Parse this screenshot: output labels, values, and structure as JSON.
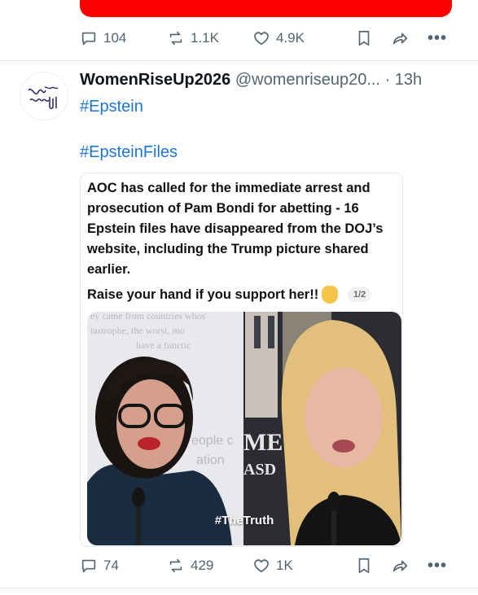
{
  "prev_post": {
    "actions": {
      "replies": "104",
      "reposts": "1.1K",
      "likes": "4.9K"
    }
  },
  "post": {
    "author_name": "WomenRiseUp2026",
    "author_handle": "@womenriseup20...",
    "separator": " · ",
    "time": "13h",
    "hashtags": [
      "#Epstein",
      "#EpsteinFiles"
    ],
    "card": {
      "text": "AOC has called for the immediate arrest and prosecution of Pam Bondi for abetting - 16 Epstein files have disappeared from the DOJ’s website, including the Trump picture shared earlier.",
      "raise_text": "Raise your hand if you support her!!",
      "page_indicator": "1/2",
      "image_caption": "#TheTruth",
      "bg_text_left": [
        "ey came from countries whos",
        "tastrophe, the worst, mo",
        "have a functic",
        "eople c",
        "ation"
      ],
      "bg_text_right": [
        "ME",
        "ASD"
      ]
    },
    "actions": {
      "replies": "74",
      "reposts": "429",
      "likes": "1K"
    }
  },
  "icons": {
    "reply": "reply-icon",
    "repost": "repost-icon",
    "like": "heart-icon",
    "bookmark": "bookmark-icon",
    "share": "share-icon",
    "more": "more-icon"
  },
  "colors": {
    "link": "#1d75d3",
    "muted": "#536471",
    "red_bar": "#fe0000"
  }
}
